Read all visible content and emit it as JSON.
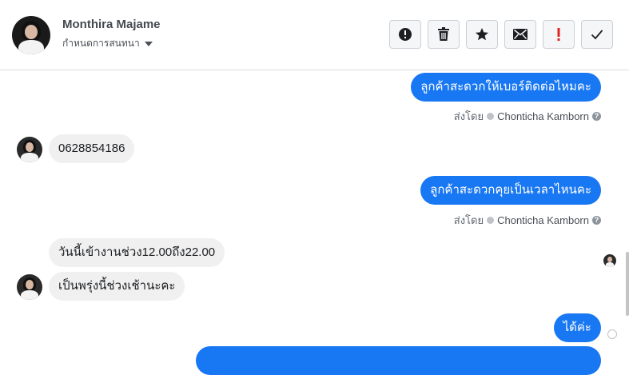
{
  "header": {
    "contact_name": "Monthira Majame",
    "assign_label": "กำหนดการสนทนา",
    "buttons": [
      {
        "name": "spam",
        "icon": "alert-circle-icon"
      },
      {
        "name": "delete",
        "icon": "trash-icon"
      },
      {
        "name": "star",
        "icon": "star-icon"
      },
      {
        "name": "mark-unread",
        "icon": "envelope-icon"
      },
      {
        "name": "follow-up",
        "icon": "exclamation-icon"
      },
      {
        "name": "done",
        "icon": "checkmark-icon"
      }
    ]
  },
  "messages": {
    "out1": "ลูกค้าสะดวกให้เบอร์ติดต่อไหมคะ",
    "sent_by_1": {
      "prefix": "ส่งโดย",
      "agent": "Chonticha Kamborn"
    },
    "in1": "0628854186",
    "out2": "ลูกค้าสะดวกคุยเป็นเวลาไหนคะ",
    "sent_by_2": {
      "prefix": "ส่งโดย",
      "agent": "Chonticha Kamborn"
    },
    "in2": "วันนี้เข้างานช่วง12.00ถึง22.00",
    "in3": "เป็นพรุ่งนี้ช่วงเช้านะคะ",
    "out3": "ได้ค่ะ"
  },
  "colors": {
    "outgoing_bubble": "#1877f2",
    "incoming_bubble": "#f0f0f0",
    "follow_up_icon": "#e02424"
  }
}
